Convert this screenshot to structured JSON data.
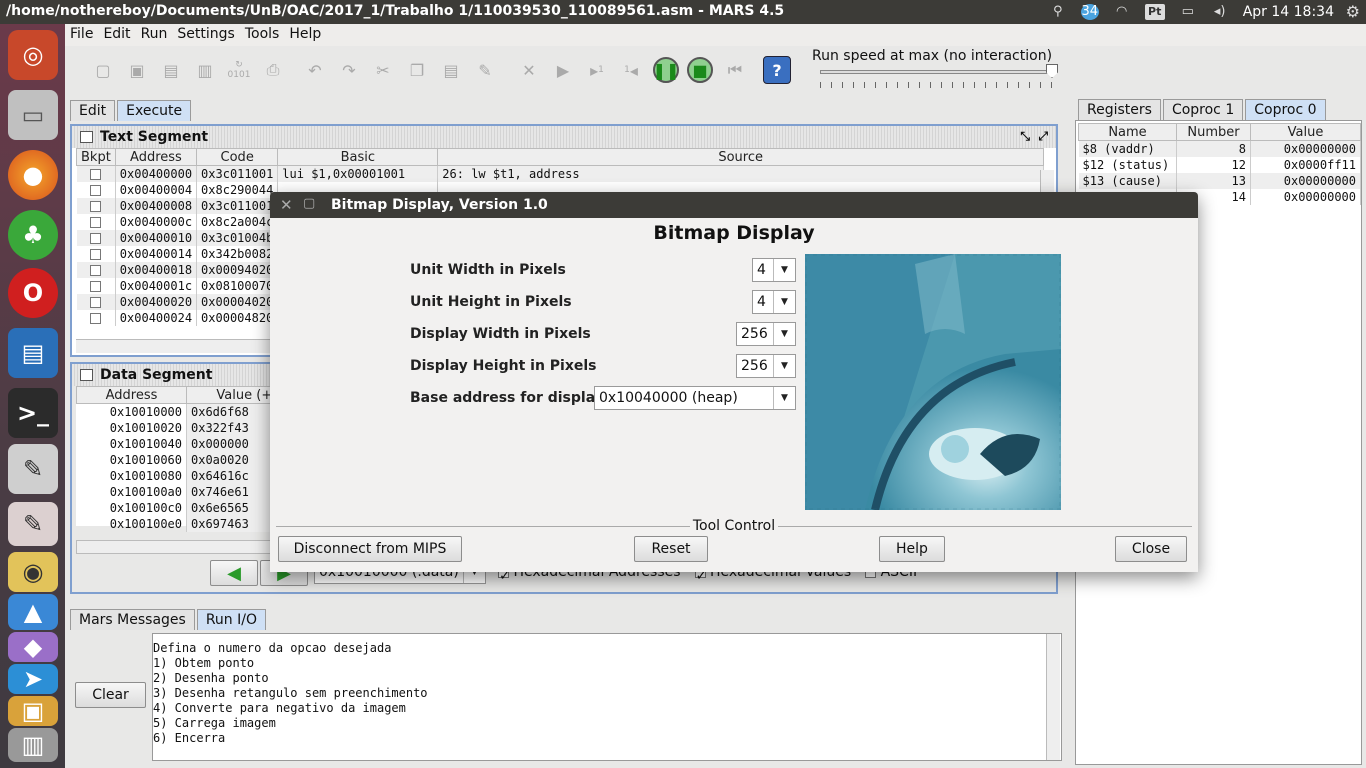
{
  "window_title": "/home/nothereboy/Documents/UnB/OAC/2017_1/Trabalho 1/110039530_110089561.asm  - MARS 4.5",
  "tray": {
    "keyboard": "Pt",
    "clock": "Apr 14 18:34",
    "badge": "34"
  },
  "menu": [
    "File",
    "Edit",
    "Run",
    "Settings",
    "Tools",
    "Help"
  ],
  "run_speed_label": "Run speed at max (no interaction)",
  "run_speed_level": 1.0,
  "toolbar_labels": {
    "assemble_text": "0101",
    "step_count": "1",
    "backstep_count": "1"
  },
  "main_tabs": [
    "Edit",
    "Execute"
  ],
  "text_segment": {
    "title": "Text Segment",
    "columns": [
      "Bkpt",
      "Address",
      "Code",
      "Basic",
      "Source"
    ],
    "rows": [
      {
        "address": "0x00400000",
        "code": "0x3c011001",
        "basic": "lui $1,0x00001001",
        "source": "26:          lw $t1, address"
      },
      {
        "address": "0x00400004",
        "code": "0x8c290044",
        "basic": "",
        "source": ""
      },
      {
        "address": "0x00400008",
        "code": "0x3c011001",
        "basic": "",
        "source": ""
      },
      {
        "address": "0x0040000c",
        "code": "0x8c2a004c",
        "basic": "",
        "source": ""
      },
      {
        "address": "0x00400010",
        "code": "0x3c01004b",
        "basic": "",
        "source": ""
      },
      {
        "address": "0x00400014",
        "code": "0x342b0082",
        "basic": "",
        "source": ""
      },
      {
        "address": "0x00400018",
        "code": "0x00094020",
        "basic": "",
        "source": ""
      },
      {
        "address": "0x0040001c",
        "code": "0x08100070",
        "basic": "",
        "source": ""
      },
      {
        "address": "0x00400020",
        "code": "0x00004020",
        "basic": "",
        "source": ""
      },
      {
        "address": "0x00400024",
        "code": "0x00004820",
        "basic": "",
        "source": ""
      }
    ]
  },
  "data_segment": {
    "title": "Data Segment",
    "columns": [
      "Address",
      "Value (+0)"
    ],
    "rows": [
      {
        "address": "0x10010000",
        "value": "0x6d6f68"
      },
      {
        "address": "0x10010020",
        "value": "0x322f43"
      },
      {
        "address": "0x10010040",
        "value": "0x000000"
      },
      {
        "address": "0x10010060",
        "value": "0x0a0020"
      },
      {
        "address": "0x10010080",
        "value": "0x64616c"
      },
      {
        "address": "0x100100a0",
        "value": "0x746e61"
      },
      {
        "address": "0x100100c0",
        "value": "0x6e6565"
      },
      {
        "address": "0x100100e0",
        "value": "0x697463"
      }
    ],
    "segment_select": "0x10010000 (.data)",
    "hex_addresses_label": "Hexadecimal Addresses",
    "hex_values_label": "Hexadecimal Values",
    "ascii_label": "ASCII",
    "hex_addresses": true,
    "hex_values": true,
    "ascii": false
  },
  "messages": {
    "tabs": [
      "Mars Messages",
      "Run I/O"
    ],
    "clear_label": "Clear",
    "lines": [
      "Defina o numero da opcao desejada",
      "1) Obtem ponto",
      "2) Desenha ponto",
      "3) Desenha retangulo sem preenchimento",
      "4) Converte para negativo da imagem",
      "5) Carrega imagem",
      "6) Encerra"
    ]
  },
  "registers": {
    "tabs": [
      "Registers",
      "Coproc 1",
      "Coproc 0"
    ],
    "columns": [
      "Name",
      "Number",
      "Value"
    ],
    "rows": [
      {
        "name": "$8 (vaddr)",
        "number": "8",
        "value": "0x00000000"
      },
      {
        "name": "$12 (status)",
        "number": "12",
        "value": "0x0000ff11"
      },
      {
        "name": "$13 (cause)",
        "number": "13",
        "value": "0x00000000"
      },
      {
        "name": "",
        "number": "14",
        "value": "0x00000000"
      }
    ]
  },
  "dialog": {
    "title": "Bitmap Display, Version 1.0",
    "heading": "Bitmap Display",
    "fields": [
      {
        "label": "Unit Width in Pixels",
        "value": "4"
      },
      {
        "label": "Unit Height in Pixels",
        "value": "4"
      },
      {
        "label": "Display Width in Pixels",
        "value": "256"
      },
      {
        "label": "Display Height in Pixels",
        "value": "256"
      },
      {
        "label": "Base address for display",
        "value": "0x10040000 (heap)"
      }
    ],
    "tool_control_label": "Tool Control",
    "buttons": [
      "Disconnect from MIPS",
      "Reset",
      "Help",
      "Close"
    ]
  },
  "colors": {
    "accent": "#cfe0f5",
    "titlebar": "#3c3b37",
    "bitmap_base": "#4d9cb0"
  }
}
